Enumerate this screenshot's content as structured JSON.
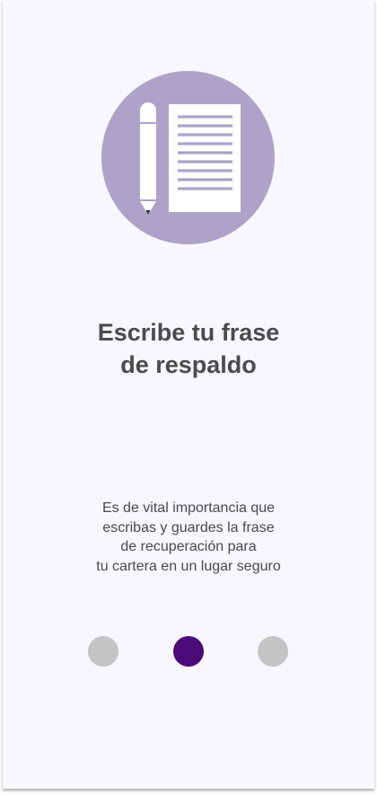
{
  "onboarding": {
    "illustration_icon": "pencil-and-paper-icon",
    "title_lines": [
      "Escribe tu frase",
      "de respaldo"
    ],
    "description_lines": [
      "Es de vital importancia que",
      "escribas y guardes la frase",
      "de recuperación para",
      "tu cartera en un lugar seguro"
    ],
    "pager": {
      "total_pages": 3,
      "current_page": 2
    }
  },
  "colors": {
    "background": "#f8f6fe",
    "illustration_circle": "#ada3c8",
    "text": "#4b4b4b",
    "dot_inactive": "#c4c4c4",
    "dot_active": "#4a0a78"
  }
}
